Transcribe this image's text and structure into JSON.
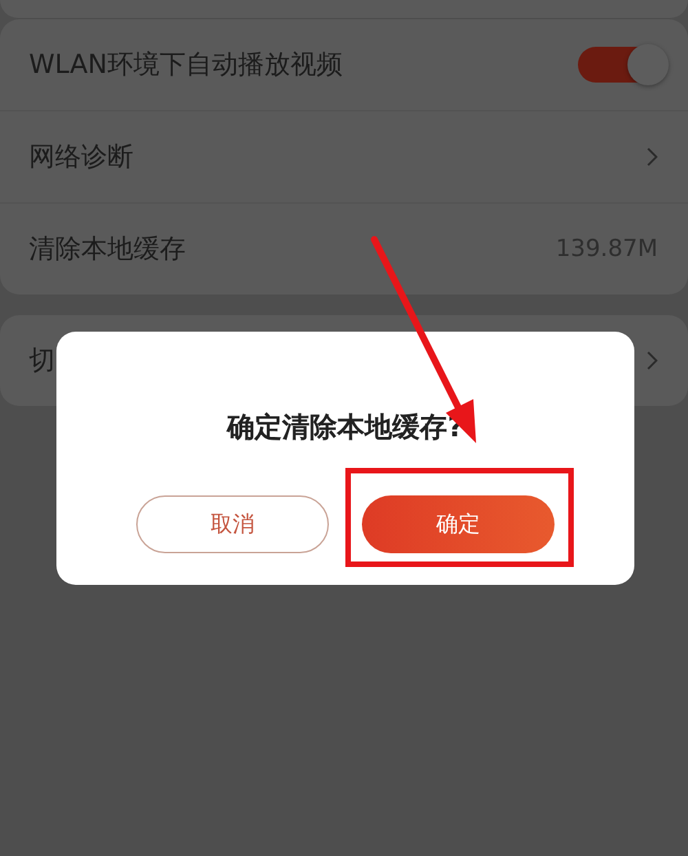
{
  "settings": [
    {
      "kind": "toggle",
      "label": "WLAN环境下自动播放视频",
      "on": true
    },
    {
      "kind": "link",
      "label": "网络诊断"
    },
    {
      "kind": "value",
      "label": "清除本地缓存",
      "value": "139.87M"
    }
  ],
  "settings_2": [
    {
      "kind": "link",
      "label": "切"
    }
  ],
  "dialog": {
    "title": "确定清除本地缓存?",
    "buttons": [
      {
        "label": "取消",
        "kind": "secondary"
      },
      {
        "label": "确定",
        "kind": "primary"
      }
    ]
  }
}
